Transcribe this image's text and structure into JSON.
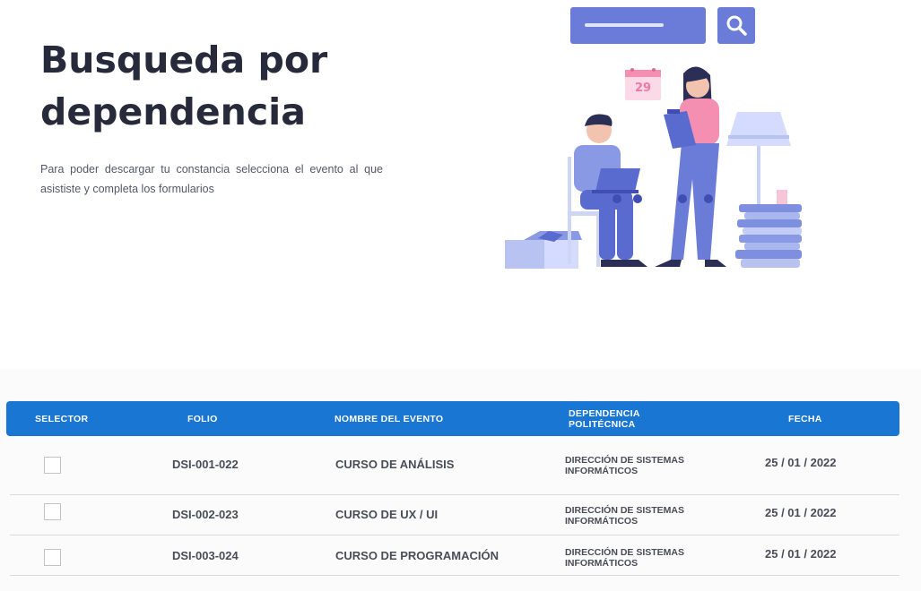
{
  "hero": {
    "title_line1": "Busqueda por",
    "title_line2": "dependencia",
    "description": "Para poder descargar tu constancia selecciona el evento al que asististe y completa los formularios"
  },
  "illustration": {
    "calendar_day": "29",
    "icons": [
      "search-icon",
      "calendar-icon",
      "laptop-icon",
      "clipboard-icon",
      "lamp-icon",
      "books-icon",
      "box-icon"
    ]
  },
  "table": {
    "headers": {
      "selector": "SELECTOR",
      "folio": "FOLIO",
      "evento": "NOMBRE DEL EVENTO",
      "dependencia_line1": "DEPENDENCIA",
      "dependencia_line2": "POLITÉCNICA",
      "fecha": "FECHA"
    },
    "rows": [
      {
        "folio": "DSI-001-022",
        "evento": "CURSO DE ANÁLISIS",
        "dep_line1": "DIRECCIÓN DE SISTEMAS",
        "dep_line2": "INFORMÁTICOS",
        "fecha": "25 / 01 / 2022",
        "selected": false
      },
      {
        "folio": "DSI-002-023",
        "evento": "CURSO DE UX / UI",
        "dep_line1": "DIRECCIÓN DE SISTEMAS",
        "dep_line2": "INFORMÁTICOS",
        "fecha": "25 / 01 / 2022",
        "selected": false
      },
      {
        "folio": "DSI-003-024",
        "evento": "CURSO DE PROGRAMACIÓN",
        "dep_line1": "DIRECCIÓN DE SISTEMAS",
        "dep_line2": "INFORMÁTICOS",
        "fecha": "25 / 01 / 2022",
        "selected": false
      }
    ]
  },
  "colors": {
    "header_blue": "#1976d2",
    "illustration_blue": "#6a7bd8",
    "accent_pink": "#f48fb1",
    "title": "#262a3b"
  }
}
